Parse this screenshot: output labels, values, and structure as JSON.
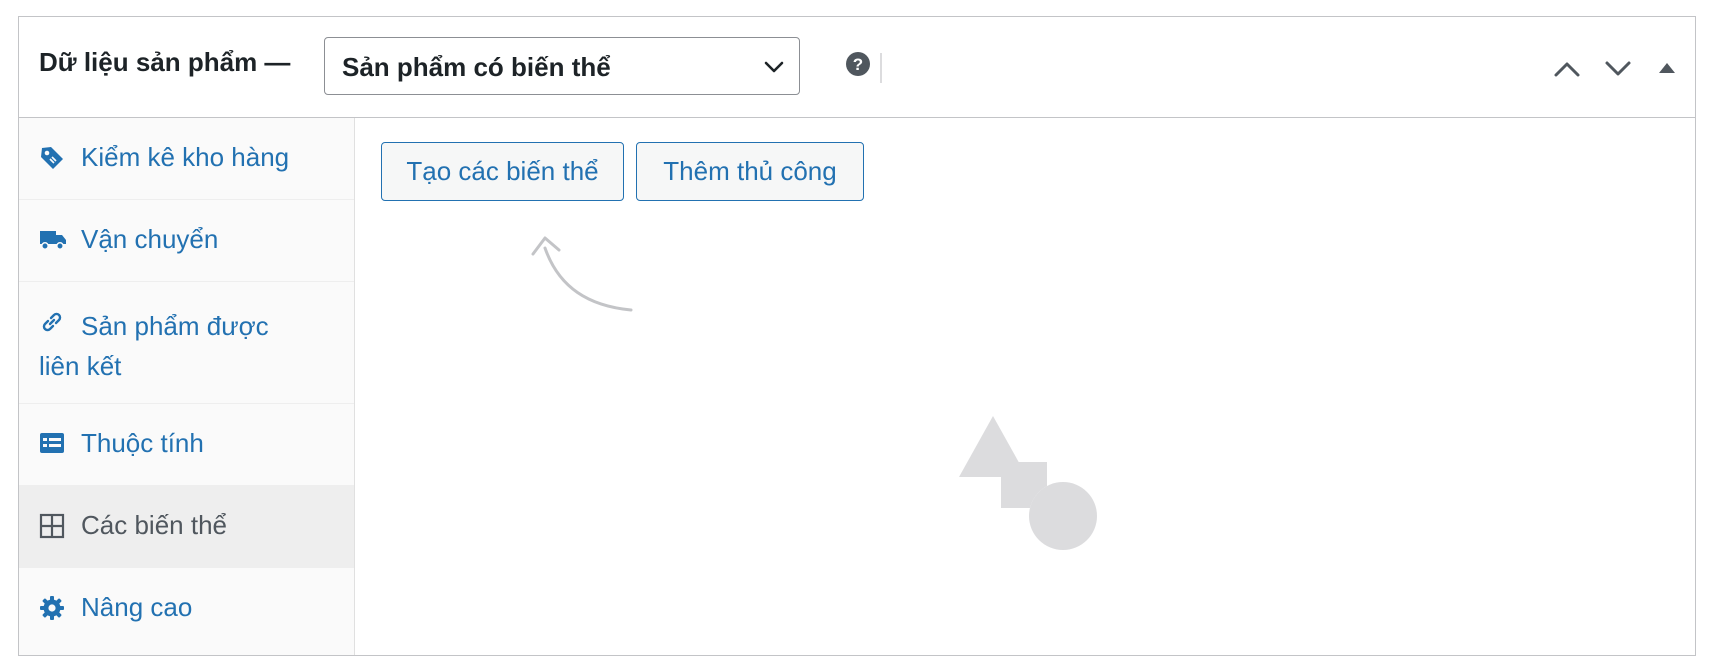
{
  "header": {
    "title": "Dữ liệu sản phẩm —",
    "product_type": "Sản phẩm có biến thể",
    "icons": [
      "help-icon",
      "move-up-icon",
      "move-down-icon",
      "toggle-panel-icon"
    ]
  },
  "sidebar": {
    "items": [
      {
        "label": "Kiểm kê kho hàng",
        "icon": "tag-icon"
      },
      {
        "label": "Vận chuyển",
        "icon": "truck-icon"
      },
      {
        "label": "Sản phẩm được liên kết",
        "icon": "link-icon"
      },
      {
        "label": "Thuộc tính",
        "icon": "list-icon"
      },
      {
        "label": "Các biến thể",
        "icon": "grid-icon",
        "active": true
      },
      {
        "label": "Nâng cao",
        "icon": "gear-icon"
      }
    ]
  },
  "content": {
    "generate_label": "Tạo các biến thể",
    "manual_label": "Thêm thủ công",
    "empty_state_icon": "shapes-illustration"
  },
  "colors": {
    "accent": "#2271b1",
    "border": "#c3c4c7",
    "active_tab_bg": "#eeeeee",
    "illustration": "#dcdcde"
  }
}
